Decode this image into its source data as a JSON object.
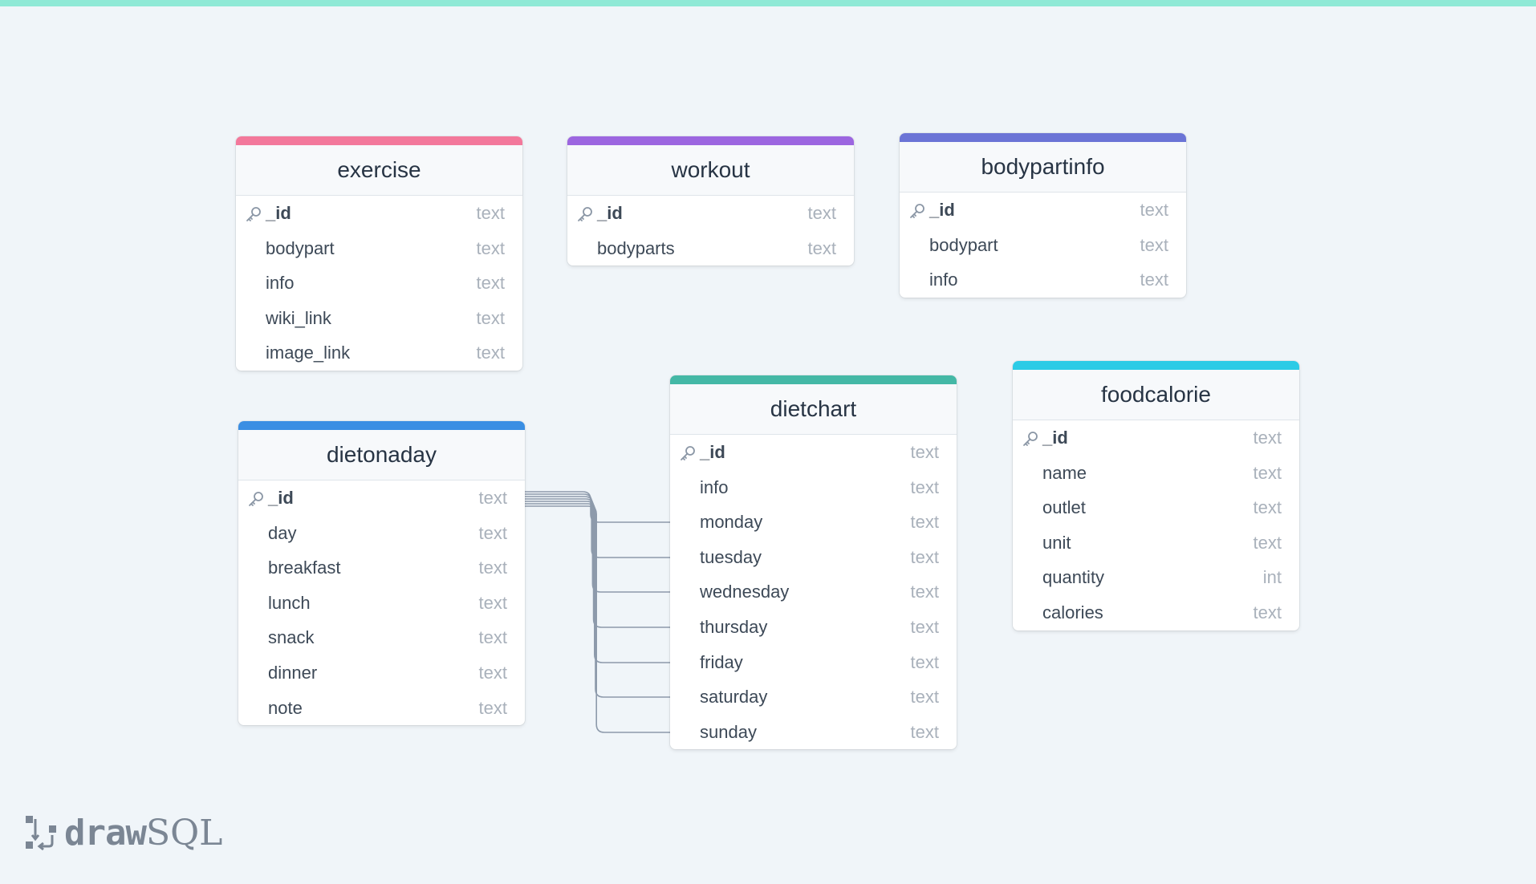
{
  "colors": {
    "background": "#f0f5f9",
    "top_accent": "#8fe9d6",
    "relation_line": "#8d9aab"
  },
  "tables": {
    "exercise": {
      "name": "exercise",
      "color": "#f3789b",
      "fields": [
        {
          "name": "_id",
          "type": "text"
        },
        {
          "name": "bodypart",
          "type": "text"
        },
        {
          "name": "info",
          "type": "text"
        },
        {
          "name": "wiki_link",
          "type": "text"
        },
        {
          "name": "image_link",
          "type": "text"
        }
      ]
    },
    "workout": {
      "name": "workout",
      "color": "#9c66e0",
      "fields": [
        {
          "name": "_id",
          "type": "text"
        },
        {
          "name": "bodyparts",
          "type": "text"
        }
      ]
    },
    "bodypartinfo": {
      "name": "bodypartinfo",
      "color": "#6b74d6",
      "fields": [
        {
          "name": "_id",
          "type": "text"
        },
        {
          "name": "bodypart",
          "type": "text"
        },
        {
          "name": "info",
          "type": "text"
        }
      ]
    },
    "dietonaday": {
      "name": "dietonaday",
      "color": "#3a8ee3",
      "fields": [
        {
          "name": "_id",
          "type": "text"
        },
        {
          "name": "day",
          "type": "text"
        },
        {
          "name": "breakfast",
          "type": "text"
        },
        {
          "name": "lunch",
          "type": "text"
        },
        {
          "name": "snack",
          "type": "text"
        },
        {
          "name": "dinner",
          "type": "text"
        },
        {
          "name": "note",
          "type": "text"
        }
      ]
    },
    "dietchart": {
      "name": "dietchart",
      "color": "#44b8a6",
      "fields": [
        {
          "name": "_id",
          "type": "text"
        },
        {
          "name": "info",
          "type": "text"
        },
        {
          "name": "monday",
          "type": "text"
        },
        {
          "name": "tuesday",
          "type": "text"
        },
        {
          "name": "wednesday",
          "type": "text"
        },
        {
          "name": "thursday",
          "type": "text"
        },
        {
          "name": "friday",
          "type": "text"
        },
        {
          "name": "saturday",
          "type": "text"
        },
        {
          "name": "sunday",
          "type": "text"
        }
      ]
    },
    "foodcalorie": {
      "name": "foodcalorie",
      "color": "#2ccbe6",
      "fields": [
        {
          "name": "_id",
          "type": "text"
        },
        {
          "name": "name",
          "type": "text"
        },
        {
          "name": "outlet",
          "type": "text"
        },
        {
          "name": "unit",
          "type": "text"
        },
        {
          "name": "quantity",
          "type": "int"
        },
        {
          "name": "calories",
          "type": "text"
        }
      ]
    }
  },
  "relations": [
    {
      "from": "dietonaday._id",
      "to": "dietchart.monday"
    },
    {
      "from": "dietonaday._id",
      "to": "dietchart.tuesday"
    },
    {
      "from": "dietonaday._id",
      "to": "dietchart.wednesday"
    },
    {
      "from": "dietonaday._id",
      "to": "dietchart.thursday"
    },
    {
      "from": "dietonaday._id",
      "to": "dietchart.friday"
    },
    {
      "from": "dietonaday._id",
      "to": "dietchart.saturday"
    },
    {
      "from": "dietonaday._id",
      "to": "dietchart.sunday"
    }
  ],
  "logo": {
    "part1": "draw",
    "part2": "SQL",
    "icon": "drawsql-logo-icon"
  }
}
